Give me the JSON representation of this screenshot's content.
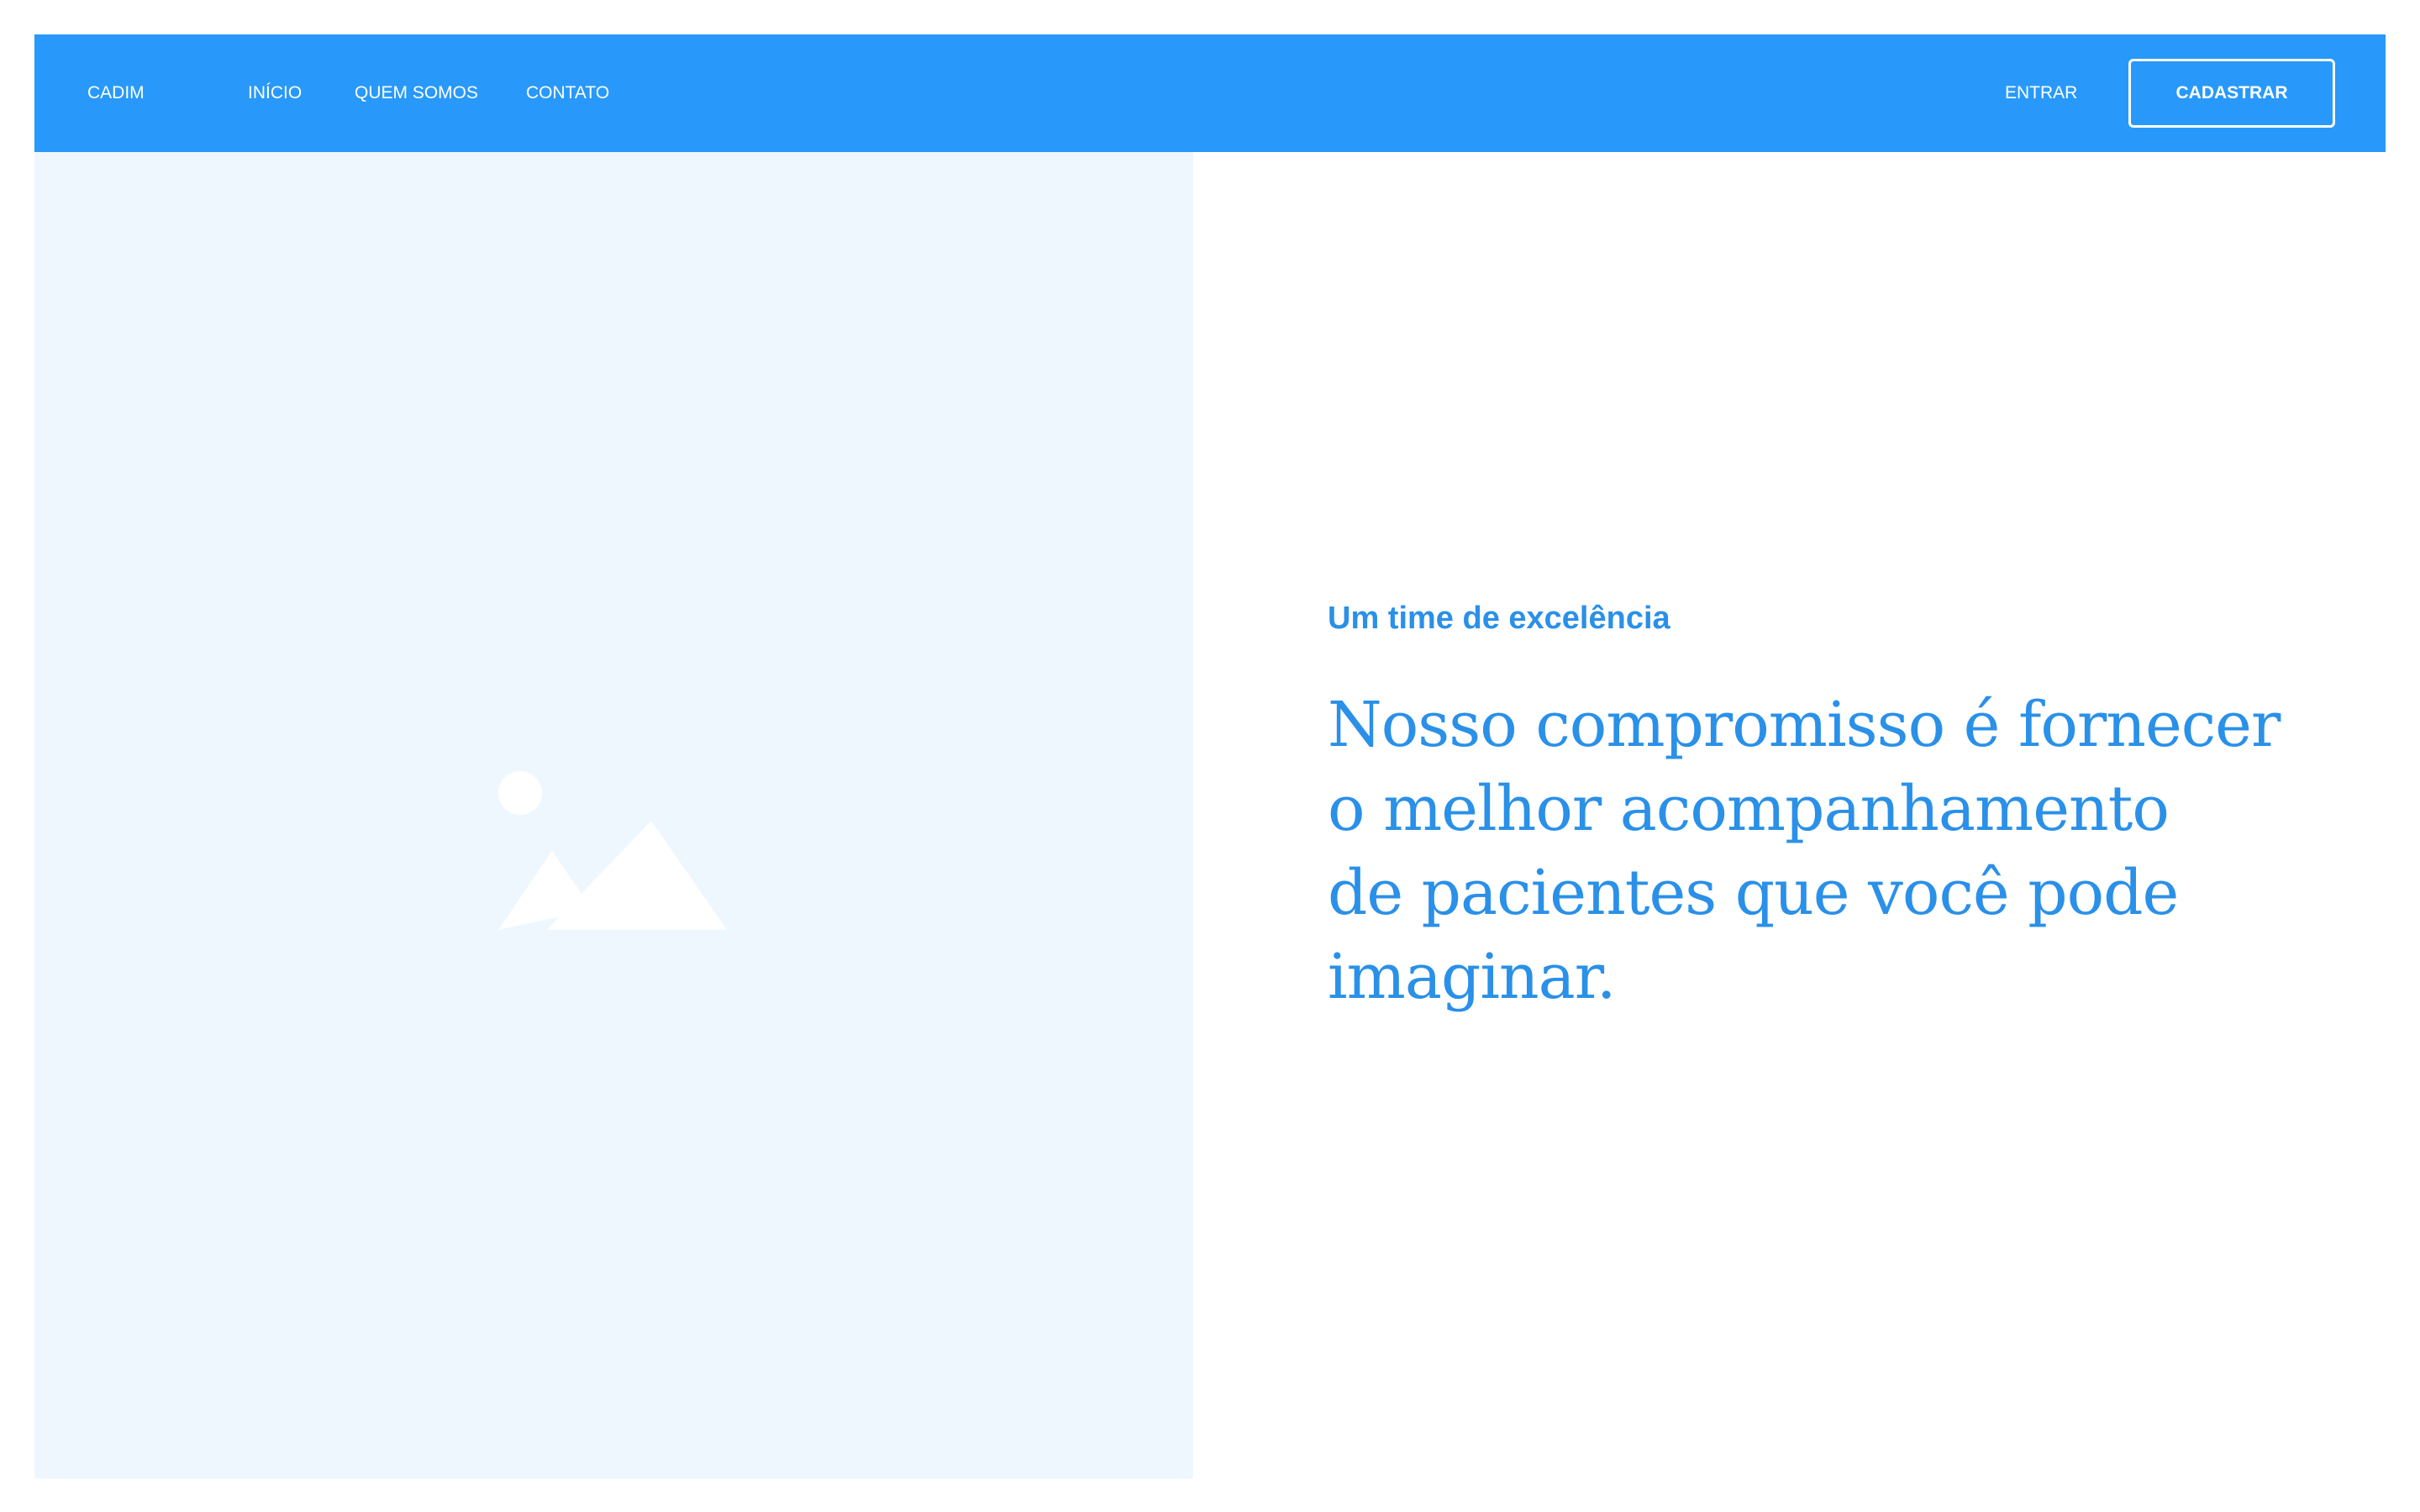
{
  "nav": {
    "brand": "CADIM",
    "links": [
      "INÍCIO",
      "QUEM SOMOS",
      "CONTATO"
    ],
    "login_label": "ENTRAR",
    "signup_label": "CADASTRAR"
  },
  "hero": {
    "image_icon": "image-placeholder-icon",
    "eyebrow": "Um time de excelência",
    "headline_lines": [
      "Nosso compromisso é fornecer",
      "o melhor acompanhamento",
      "de pacientes que você pode",
      "imaginar."
    ]
  },
  "colors": {
    "navbar_bg": "#2899fb",
    "accent_text": "#2a90e8",
    "image_panel_bg": "#eff7fe"
  }
}
